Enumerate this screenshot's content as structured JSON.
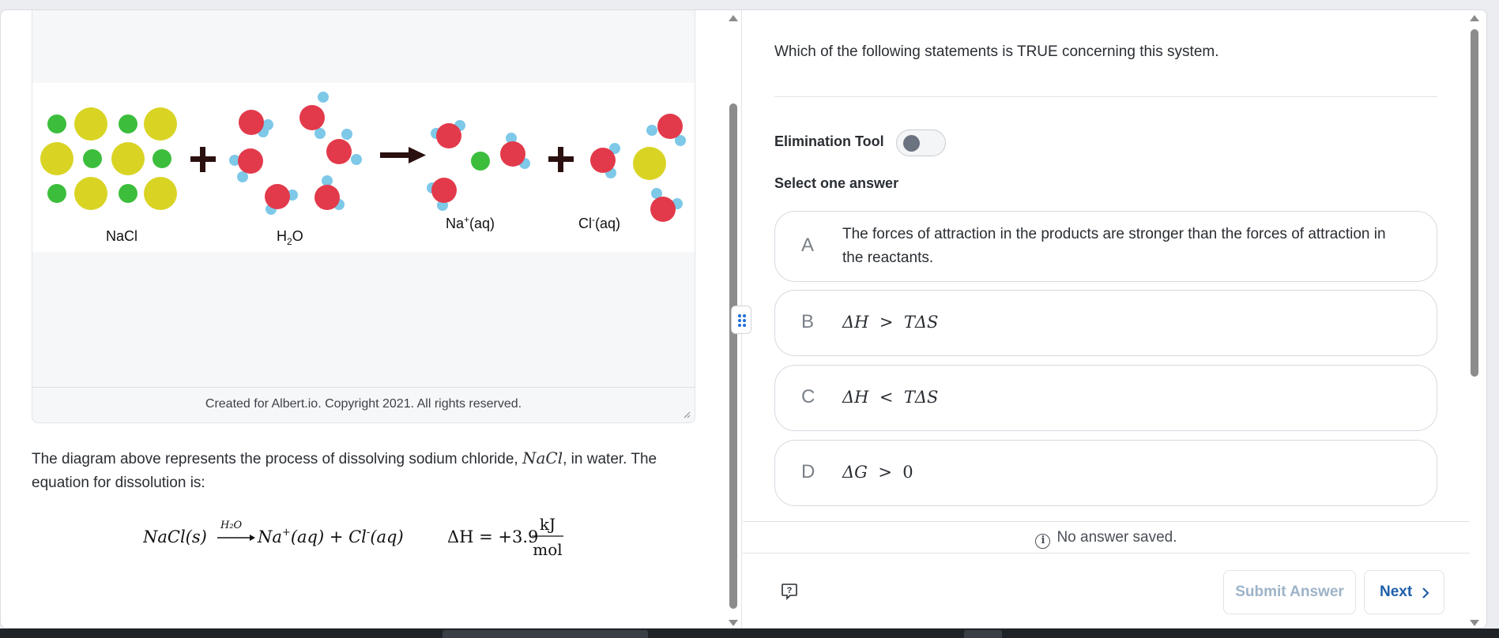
{
  "figure": {
    "labels": {
      "nacl": "NaCl",
      "h2o_main": "H",
      "h2o_sub": "2",
      "h2o_end": "O",
      "na_main": "Na",
      "na_sup": "+",
      "na_end": "(aq)",
      "cl_main": "Cl",
      "cl_sup": "-",
      "cl_end": "(aq)",
      "plus": "+"
    },
    "colors": {
      "na_atom": "#3cbe3c",
      "cl_atom": "#d9d424",
      "oxygen": "#e23a4b",
      "hydrogen": "#7ec8e8",
      "symbol": "#2b1010"
    },
    "caption": "Created for Albert.io. Copyright 2021. All rights reserved."
  },
  "passage": {
    "text_before": "The diagram above represents the process of dissolving sodium chloride, ",
    "math": "NaCl",
    "text_after": ", in water. The equation for dissolution is:"
  },
  "equation": {
    "reactant": "NaCl(s)",
    "arrow_label": "H₂O",
    "product_na": "Na",
    "product_na_sup": "+",
    "product_na_state": "(aq) + ",
    "product_cl": "Cl",
    "product_cl_sup": "-",
    "product_cl_state": "(aq)",
    "delta_h": "ΔH = +3.9",
    "unit_num": "kJ",
    "unit_den": "mol"
  },
  "question": {
    "prompt": "Which of the following statements is TRUE concerning this system.",
    "elimination_label": "Elimination Tool",
    "elimination_on": false,
    "select_label": "Select one answer",
    "options": [
      {
        "letter": "A",
        "text": "The forces of attraction in the products are stronger than the forces of attraction in the reactants."
      },
      {
        "letter": "B",
        "lhs": "ΔH",
        "op": ">",
        "rhs": "TΔS"
      },
      {
        "letter": "C",
        "lhs": "ΔH",
        "op": "<",
        "rhs": "TΔS"
      },
      {
        "letter": "D",
        "lhs": "ΔG",
        "op": ">",
        "rhs": "0"
      }
    ]
  },
  "status": {
    "icon": "info-icon",
    "text": "No answer saved."
  },
  "footer": {
    "help_icon": "help-chat-icon",
    "submit_label": "Submit Answer",
    "next_label": "Next"
  }
}
